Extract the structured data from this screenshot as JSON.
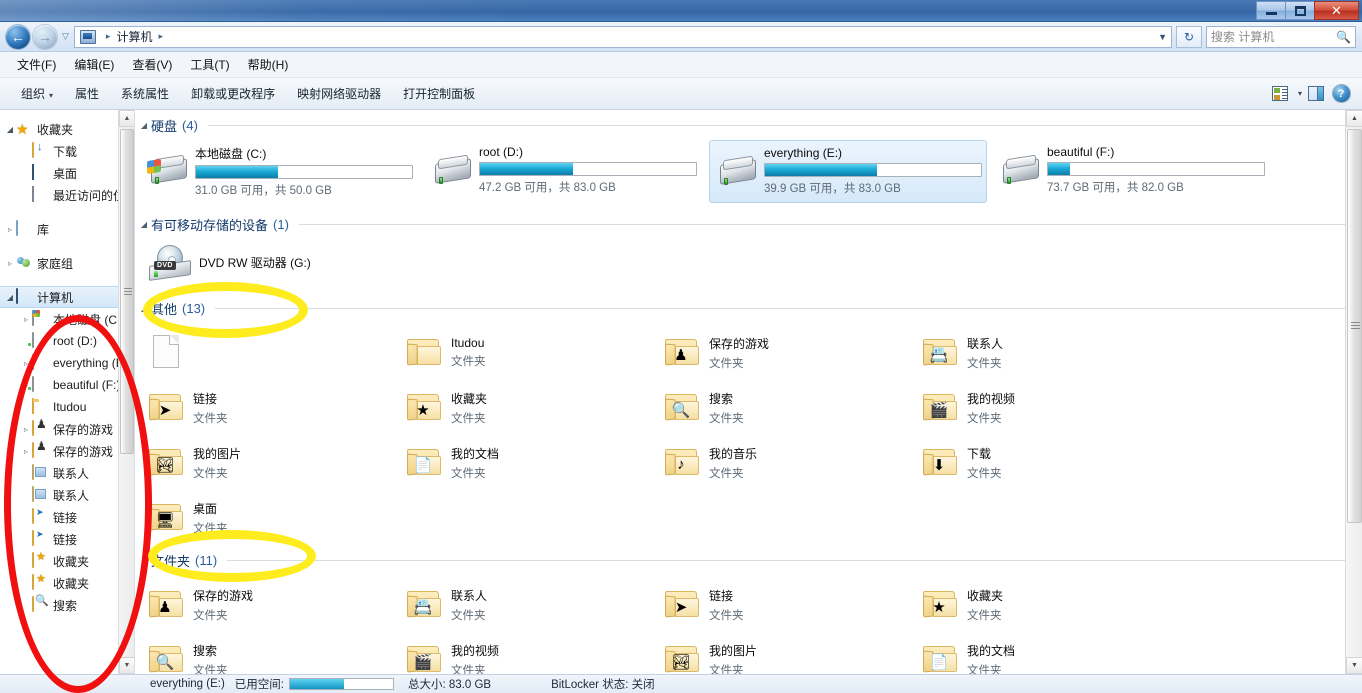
{
  "window": {
    "minimize_label": "",
    "maximize_label": "",
    "close_label": "✕"
  },
  "address_bar": {
    "breadcrumb": [
      "计算机"
    ],
    "separator": "▸",
    "dropdown_caret": "▼",
    "refresh_label": "↻",
    "history_caret": "▽"
  },
  "search": {
    "placeholder": "搜索 计算机",
    "icon": "🔍"
  },
  "menu": {
    "items": [
      {
        "label": "文件(F)"
      },
      {
        "label": "编辑(E)"
      },
      {
        "label": "查看(V)"
      },
      {
        "label": "工具(T)"
      },
      {
        "label": "帮助(H)"
      }
    ]
  },
  "toolbar": {
    "items": [
      {
        "label": "组织",
        "caret": "▾"
      },
      {
        "label": "属性",
        "caret": ""
      },
      {
        "label": "系统属性",
        "caret": ""
      },
      {
        "label": "卸载或更改程序",
        "caret": ""
      },
      {
        "label": "映射网络驱动器",
        "caret": ""
      },
      {
        "label": "打开控制面板",
        "caret": ""
      }
    ],
    "views_caret": "▾",
    "help_label": "?"
  },
  "sidebar": {
    "items": [
      {
        "label": "收藏夹",
        "icon": "star-icon",
        "expander": "◢",
        "indent": 0,
        "selected": false
      },
      {
        "label": "下载",
        "icon": "downloads-icon",
        "expander": "",
        "indent": 1,
        "selected": false
      },
      {
        "label": "桌面",
        "icon": "desktop-icon",
        "expander": "",
        "indent": 1,
        "selected": false
      },
      {
        "label": "最近访问的位置",
        "icon": "recent-places-icon",
        "expander": "",
        "indent": 1,
        "selected": false
      },
      {
        "label": "",
        "icon": "",
        "expander": "",
        "indent": 0,
        "selected": false
      },
      {
        "label": "库",
        "icon": "library-icon",
        "expander": "▹",
        "indent": 0,
        "selected": false
      },
      {
        "label": "",
        "icon": "",
        "expander": "",
        "indent": 0,
        "selected": false
      },
      {
        "label": "家庭组",
        "icon": "homegroup-icon",
        "expander": "▹",
        "indent": 0,
        "selected": false
      },
      {
        "label": "",
        "icon": "",
        "expander": "",
        "indent": 0,
        "selected": false
      },
      {
        "label": "计算机",
        "icon": "computer-icon",
        "expander": "◢",
        "indent": 0,
        "selected": true
      },
      {
        "label": "本地磁盘 (C:)",
        "icon": "windows-drive-icon",
        "expander": "▹",
        "indent": 1,
        "selected": false
      },
      {
        "label": "root (D:)",
        "icon": "drive-icon",
        "expander": "",
        "indent": 1,
        "selected": false
      },
      {
        "label": "everything (E:)",
        "icon": "drive-icon",
        "expander": "▹",
        "indent": 1,
        "selected": false
      },
      {
        "label": "beautiful (F:)",
        "icon": "drive-icon",
        "expander": "▹",
        "indent": 1,
        "selected": false
      },
      {
        "label": "Itudou",
        "icon": "folder-icon",
        "expander": "",
        "indent": 1,
        "selected": false
      },
      {
        "label": "保存的游戏",
        "icon": "saved-games-icon",
        "expander": "▹",
        "indent": 1,
        "selected": false
      },
      {
        "label": "保存的游戏",
        "icon": "saved-games-icon",
        "expander": "▹",
        "indent": 1,
        "selected": false
      },
      {
        "label": "联系人",
        "icon": "contacts-icon",
        "expander": "",
        "indent": 1,
        "selected": false
      },
      {
        "label": "联系人",
        "icon": "contacts-icon",
        "expander": "",
        "indent": 1,
        "selected": false
      },
      {
        "label": "链接",
        "icon": "links-icon",
        "expander": "",
        "indent": 1,
        "selected": false
      },
      {
        "label": "链接",
        "icon": "links-icon",
        "expander": "",
        "indent": 1,
        "selected": false
      },
      {
        "label": "收藏夹",
        "icon": "favorites-icon",
        "expander": "",
        "indent": 1,
        "selected": false
      },
      {
        "label": "收藏夹",
        "icon": "favorites-icon",
        "expander": "",
        "indent": 1,
        "selected": false
      },
      {
        "label": "搜索",
        "icon": "searches-icon",
        "expander": "",
        "indent": 1,
        "selected": false
      }
    ]
  },
  "main": {
    "groups": [
      {
        "name": "硬盘",
        "count": "(4)",
        "tri": "◢"
      },
      {
        "name": "有可移动存储的设备",
        "count": "(1)",
        "tri": "◢"
      },
      {
        "name": "其他",
        "count": "(13)",
        "tri": "◢"
      },
      {
        "name": "文件夹",
        "count": "(11)",
        "tri": "◢"
      }
    ],
    "drives": [
      {
        "name": "本地磁盘 (C:)",
        "sub": "31.0 GB 可用，共 50.0 GB",
        "used_pct": 38,
        "selected": false,
        "icon": "windows-hard-drive-icon"
      },
      {
        "name": "root (D:)",
        "sub": "47.2 GB 可用，共 83.0 GB",
        "used_pct": 43,
        "selected": false,
        "icon": "hard-drive-icon"
      },
      {
        "name": "everything (E:)",
        "sub": "39.9 GB 可用，共 83.0 GB",
        "used_pct": 52,
        "selected": true,
        "icon": "hard-drive-icon"
      },
      {
        "name": "beautiful (F:)",
        "sub": "73.7 GB 可用，共 82.0 GB",
        "used_pct": 10,
        "selected": false,
        "icon": "hard-drive-icon"
      }
    ],
    "removable": [
      {
        "name": "DVD RW 驱动器 (G:)",
        "badge": "DVD",
        "icon": "dvd-drive-icon"
      }
    ],
    "other_items": [
      {
        "name": "",
        "type": "",
        "icon": "generic-file-icon",
        "emblem": ""
      },
      {
        "name": "Itudou",
        "type": "文件夹",
        "icon": "folder-icon",
        "emblem": ""
      },
      {
        "name": "保存的游戏",
        "type": "文件夹",
        "icon": "saved-games-folder-icon",
        "emblem": "♟"
      },
      {
        "name": "联系人",
        "type": "文件夹",
        "icon": "contacts-folder-icon",
        "emblem": "📇"
      },
      {
        "name": "链接",
        "type": "文件夹",
        "icon": "links-folder-icon",
        "emblem": "➤"
      },
      {
        "name": "收藏夹",
        "type": "文件夹",
        "icon": "favorites-folder-icon",
        "emblem": "★"
      },
      {
        "name": "搜索",
        "type": "文件夹",
        "icon": "searches-folder-icon",
        "emblem": "🔍"
      },
      {
        "name": "我的视频",
        "type": "文件夹",
        "icon": "videos-folder-icon",
        "emblem": "🎬"
      },
      {
        "name": "我的图片",
        "type": "文件夹",
        "icon": "pictures-folder-icon",
        "emblem": "🏞"
      },
      {
        "name": "我的文档",
        "type": "文件夹",
        "icon": "documents-folder-icon",
        "emblem": "📄"
      },
      {
        "name": "我的音乐",
        "type": "文件夹",
        "icon": "music-folder-icon",
        "emblem": "♪"
      },
      {
        "name": "下载",
        "type": "文件夹",
        "icon": "downloads-folder-icon",
        "emblem": "⬇"
      },
      {
        "name": "桌面",
        "type": "文件夹",
        "icon": "desktop-folder-icon",
        "emblem": "🖥"
      }
    ],
    "folder_items": [
      {
        "name": "保存的游戏",
        "type": "文件夹",
        "icon": "saved-games-folder-icon",
        "emblem": "♟"
      },
      {
        "name": "联系人",
        "type": "文件夹",
        "icon": "contacts-folder-icon",
        "emblem": "📇"
      },
      {
        "name": "链接",
        "type": "文件夹",
        "icon": "links-folder-icon",
        "emblem": "➤"
      },
      {
        "name": "收藏夹",
        "type": "文件夹",
        "icon": "favorites-folder-icon",
        "emblem": "★"
      },
      {
        "name": "搜索",
        "type": "文件夹",
        "icon": "searches-folder-icon",
        "emblem": "🔍"
      },
      {
        "name": "我的视频",
        "type": "文件夹",
        "icon": "videos-folder-icon",
        "emblem": "🎬"
      },
      {
        "name": "我的图片",
        "type": "文件夹",
        "icon": "pictures-folder-icon",
        "emblem": "🏞"
      },
      {
        "name": "我的文档",
        "type": "文件夹",
        "icon": "documents-folder-icon",
        "emblem": "📄"
      }
    ]
  },
  "status_bar": {
    "item_label": "everything (E:)",
    "used_label": "已用空间:",
    "used_pct": 52,
    "total_label": "总大小: 83.0 GB",
    "bitlocker_label": "BitLocker 状态: 关闭"
  },
  "scrollbars": {
    "up_arrow": "▲",
    "down_arrow": "▼"
  },
  "colors": {
    "accent": "#19a8d4",
    "title_blue": "#3a6aa8",
    "group_header": "#123a6d",
    "annotation_red": "#f01010",
    "annotation_yellow": "#ffec1f"
  }
}
